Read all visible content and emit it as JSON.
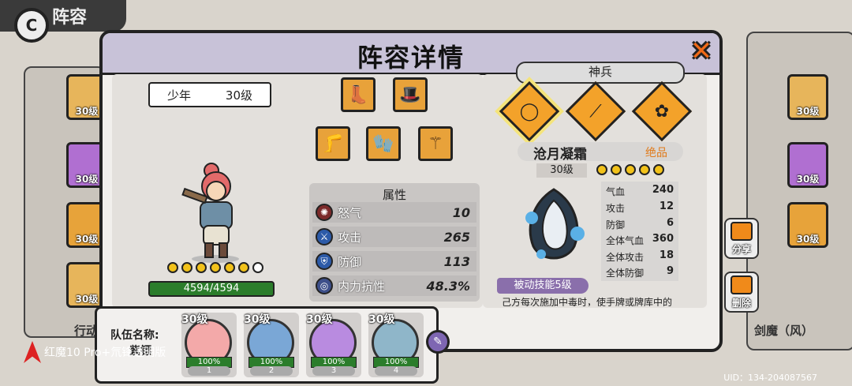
{
  "page_title": "阵容",
  "modal": {
    "title": "阵容详情",
    "close_label": "✕"
  },
  "hero": {
    "name": "少年",
    "level": "30级",
    "hp": "4594/4594",
    "attr_title": "属性",
    "attrs": [
      {
        "name": "怒气",
        "value": "10"
      },
      {
        "name": "攻击",
        "value": "265"
      },
      {
        "name": "防御",
        "value": "113"
      },
      {
        "name": "内力抗性",
        "value": "48.3%"
      }
    ]
  },
  "weapon": {
    "section_label": "神兵",
    "name": "沧月凝霜",
    "grade": "绝品",
    "level": "30级",
    "stats": [
      {
        "name": "气血",
        "value": "240"
      },
      {
        "name": "攻击",
        "value": "12"
      },
      {
        "name": "防御",
        "value": "6"
      },
      {
        "name": "全体气血",
        "value": "360"
      },
      {
        "name": "全体攻击",
        "value": "18"
      },
      {
        "name": "全体防御",
        "value": "9"
      }
    ],
    "skill_label": "被动技能5级",
    "skill_desc": "己方每次施加中毒时，使手牌或牌库中的"
  },
  "side_buttons": {
    "share": "分享",
    "delete": "删除"
  },
  "team": {
    "label": "队伍名称:",
    "name": "紫镖",
    "slots": [
      {
        "level": "30级",
        "pct": "100%",
        "num": "1"
      },
      {
        "level": "30级",
        "pct": "100%",
        "num": "2"
      },
      {
        "level": "30级",
        "pct": "100%",
        "num": "3"
      },
      {
        "level": "30级",
        "pct": "100%",
        "num": "4"
      }
    ]
  },
  "background": {
    "left_cards": [
      "30级",
      "30级",
      "30级",
      "30级"
    ],
    "left_label": "行动",
    "right_cards": [
      "30级",
      "30级",
      "30级"
    ],
    "right_label": "剑魔（风）"
  },
  "watermark": "红魔10 Pro+氘锋透明版",
  "uid": "UID：134-204087567"
}
